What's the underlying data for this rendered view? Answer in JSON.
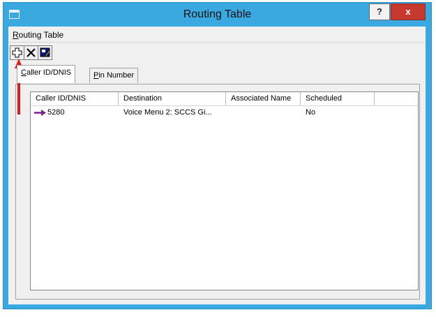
{
  "window": {
    "title": "Routing Table",
    "help_label": "?",
    "close_label": "x",
    "titlebar_color": "#3aa9e0",
    "close_color": "#c7392f"
  },
  "menu": {
    "items": [
      {
        "label": "Routing Table",
        "accel": "R"
      }
    ]
  },
  "toolbar": {
    "buttons": [
      {
        "name": "add-route-button",
        "icon": "plus-icon"
      },
      {
        "name": "delete-route-button",
        "icon": "x-icon"
      },
      {
        "name": "edit-route-button",
        "icon": "edit-icon"
      }
    ]
  },
  "tabs": [
    {
      "label": "Caller ID/DNIS",
      "accel": "C",
      "active": true
    },
    {
      "label": "Pin Number",
      "accel": "P",
      "active": false
    }
  ],
  "table": {
    "columns": [
      "Caller ID/DNIS",
      "Destination",
      "Associated Name",
      "Scheduled",
      ""
    ],
    "rows": [
      {
        "caller_id": "5280",
        "destination": "Voice Menu 2: SCCS Gi...",
        "associated_name": "",
        "scheduled": "No",
        "icon": "route-arrow-icon"
      }
    ]
  },
  "annotation": {
    "icon": "red-arrow-pointer",
    "color": "#e01b1b"
  }
}
